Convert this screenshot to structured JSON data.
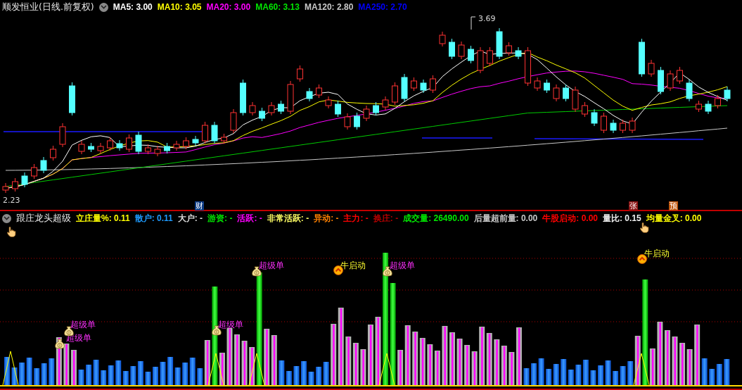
{
  "title": {
    "name": "顺发恒业(日线.前复权)"
  },
  "ma_legend": [
    {
      "label": "MA5:",
      "value": "3.00",
      "color": "#ffffff"
    },
    {
      "label": "MA10:",
      "value": "3.05",
      "color": "#ffff00"
    },
    {
      "label": "MA20:",
      "value": "3.00",
      "color": "#ff00ff"
    },
    {
      "label": "MA60:",
      "value": "3.13",
      "color": "#00e600"
    },
    {
      "label": "MA120:",
      "value": "2.80",
      "color": "#c8c8c8"
    },
    {
      "label": "MA250:",
      "value": "2.70",
      "color": "#0000ff"
    }
  ],
  "price_labels": [
    {
      "text": "3.69"
    },
    {
      "text": "2.23"
    }
  ],
  "event_markers": [
    {
      "text": "财",
      "color": "#0d3b84"
    },
    {
      "text": "张",
      "color": "#8b1414"
    },
    {
      "text": "预",
      "color": "#c0560c"
    }
  ],
  "indicator": {
    "name": "跟庄龙头超级",
    "fields": [
      {
        "label": "立庄量%:",
        "value": "0.11",
        "color": "#ffff00"
      },
      {
        "label": "散户:",
        "value": "0.11",
        "color": "#1e9bff"
      },
      {
        "label": "大户:",
        "value": "-",
        "color": "#dcdcdc"
      },
      {
        "label": "游资:",
        "value": "-",
        "color": "#00e600"
      },
      {
        "label": "活跃:",
        "value": "-",
        "color": "#ff00ff"
      },
      {
        "label": "非常活跃:",
        "value": "-",
        "color": "#ffff64"
      },
      {
        "label": "异动:",
        "value": "-",
        "color": "#ff8000"
      },
      {
        "label": "主力:",
        "value": "-",
        "color": "#ff0000"
      },
      {
        "label": "换庄:",
        "value": "-",
        "color": "#b40000"
      },
      {
        "label": "成交量:",
        "value": "26490.00",
        "color": "#00e600"
      },
      {
        "label": "后量超前量:",
        "value": "0.00",
        "color": "#c8c8c8"
      },
      {
        "label": "牛股启动:",
        "value": "0.00",
        "color": "#ff0000"
      },
      {
        "label": "量比:",
        "value": "0.15",
        "color": "#f0f0f0"
      },
      {
        "label": "均量金叉:",
        "value": "0.00",
        "color": "#ffff00"
      }
    ]
  },
  "signals": [
    {
      "kind": "bag",
      "text": "超级单"
    },
    {
      "kind": "bag",
      "text": "超级单"
    },
    {
      "kind": "bag",
      "text": "超级单"
    },
    {
      "kind": "bag",
      "text": "超级单"
    },
    {
      "kind": "bull",
      "text": "牛启动"
    },
    {
      "kind": "bag",
      "text": "超级单"
    },
    {
      "kind": "bull",
      "text": "牛启动"
    }
  ]
}
